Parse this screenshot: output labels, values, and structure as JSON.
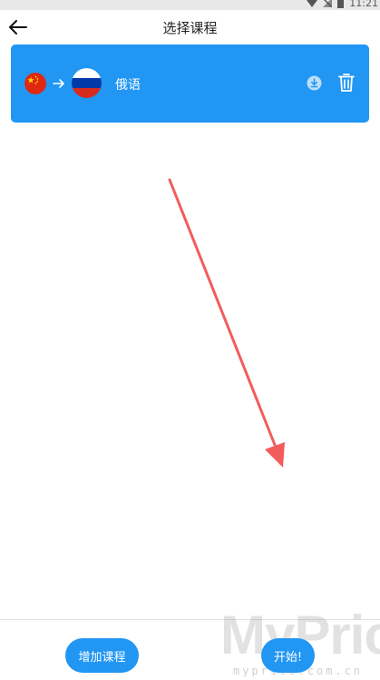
{
  "status_bar": {
    "time": "11:21"
  },
  "toolbar": {
    "title": "选择课程"
  },
  "course": {
    "name": "俄语"
  },
  "actions": {
    "add_course_label": "增加课程",
    "start_label": "开始!"
  },
  "watermark": {
    "brand": "MyPrice",
    "domain": "myprice.com.cn"
  },
  "colors": {
    "primary": "#2196f3",
    "annotation_arrow": "#f25c5c",
    "text_on_primary": "#ffffff"
  },
  "icons": {
    "back": "arrow-left-icon",
    "source_flag": "china-flag-icon",
    "target_flag": "russia-flag-icon",
    "direction": "arrow-right-icon",
    "download": "download-icon",
    "delete": "trash-icon"
  }
}
